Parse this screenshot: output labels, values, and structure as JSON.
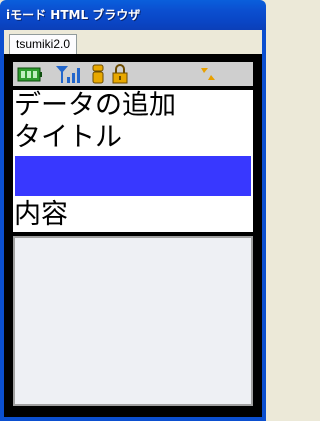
{
  "window": {
    "title": "iモード HTML ブラウザ",
    "tab_label": "tsumiki2.0"
  },
  "status_bar": {
    "icons": [
      "battery-icon",
      "signal-antenna-icon",
      "i-mode-icon",
      "lock-icon",
      "data-transfer-arrows-icon"
    ],
    "colors": {
      "battery": "#2e9d2e",
      "antenna": "#2266cc",
      "imode": "#e8a800",
      "lock": "#e8a800",
      "arrows": "#e8a000"
    }
  },
  "page": {
    "heading": "データの追加",
    "title_label": "タイトル",
    "title_value": "",
    "content_label": "内容",
    "content_value": ""
  },
  "colors": {
    "title_bar": "#0b4fd0",
    "screen_bg": "#000000",
    "focused_input": "#3838ff",
    "textarea_bg": "#eef0f4"
  }
}
